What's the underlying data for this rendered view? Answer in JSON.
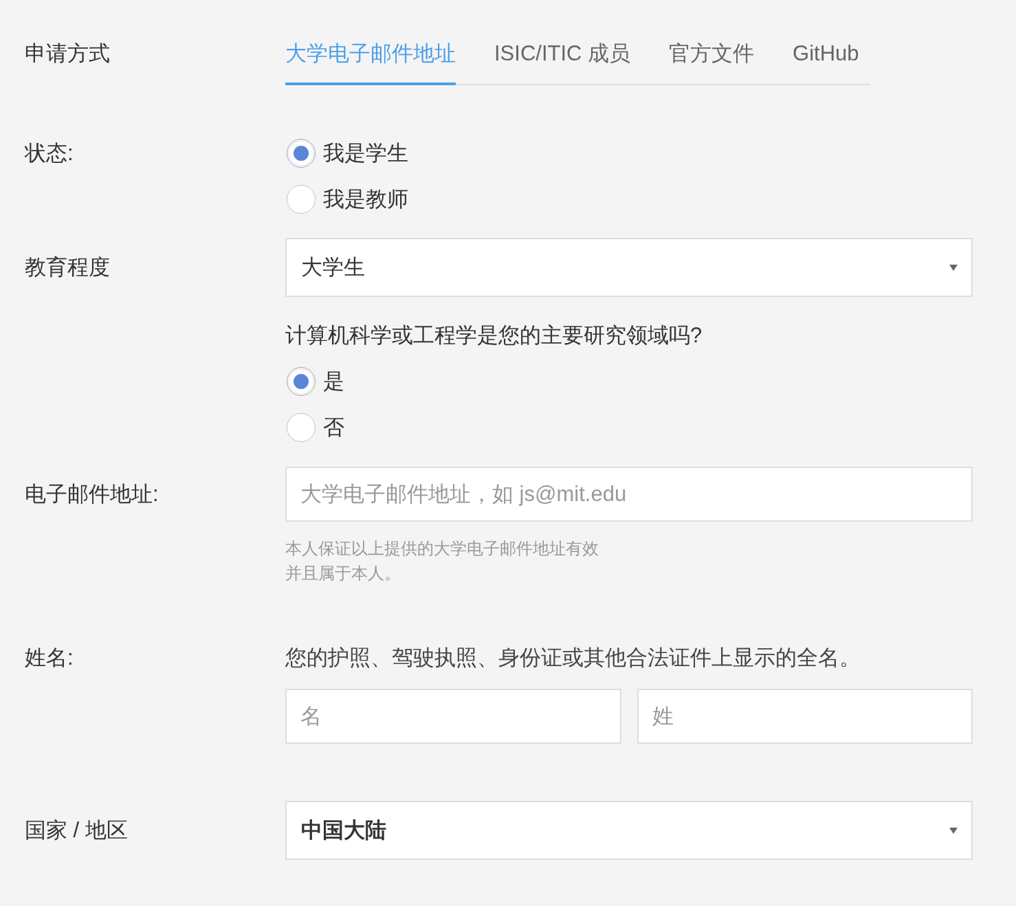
{
  "apply_method": {
    "label": "申请方式",
    "tabs": [
      {
        "label": "大学电子邮件地址",
        "selected": true
      },
      {
        "label": "ISIC/ITIC 成员",
        "selected": false
      },
      {
        "label": "官方文件",
        "selected": false
      },
      {
        "label": "GitHub",
        "selected": false
      }
    ]
  },
  "status": {
    "label": "状态:",
    "options": [
      {
        "label": "我是学生",
        "selected": true
      },
      {
        "label": "我是教师",
        "selected": false
      }
    ]
  },
  "education": {
    "label": "教育程度",
    "value": "大学生"
  },
  "cs_question": {
    "text": "计算机科学或工程学是您的主要研究领域吗?",
    "options": [
      {
        "label": "是",
        "selected": true
      },
      {
        "label": "否",
        "selected": false
      }
    ]
  },
  "email": {
    "label": "电子邮件地址:",
    "placeholder": "大学电子邮件地址，如 js@mit.edu",
    "note": [
      "本人保证以上提供的大学电子邮件地址有效",
      "并且属于本人。"
    ]
  },
  "name": {
    "label": "姓名:",
    "hint": "您的护照、驾驶执照、身份证或其他合法证件上显示的全名。",
    "fields": [
      {
        "placeholder": "名"
      },
      {
        "placeholder": "姓"
      }
    ]
  },
  "country": {
    "label": "国家 / 地区",
    "value": "中国大陆"
  }
}
